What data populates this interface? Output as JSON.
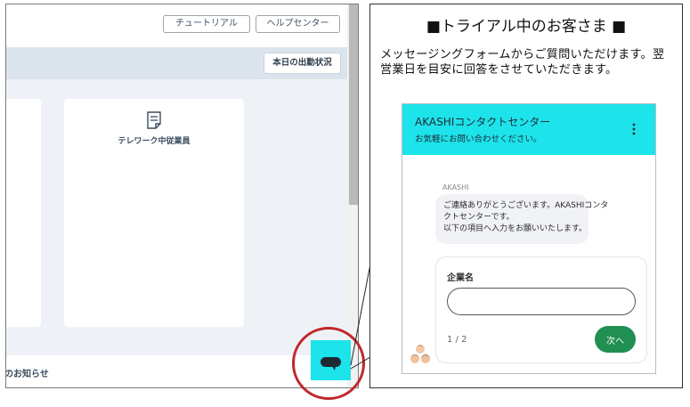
{
  "app": {
    "toolbar": {
      "tutorial_label": "チュートリアル",
      "help_label": "ヘルプセンター"
    },
    "subbar": {
      "today_button_label": "本日の出勤状況"
    },
    "cards": [
      {
        "label": "テレワーク中従業員",
        "icon": "document-icon"
      }
    ],
    "footer": {
      "news_label": "のお知らせ"
    },
    "chat_launcher": {
      "icon": "chat-bubble-icon"
    }
  },
  "callout": {
    "title": "■トライアル中のお客さま ■",
    "description": "メッセージングフォームからご質問いただけます。翌営業日を目安に回答をさせていただきます。"
  },
  "chat": {
    "header": {
      "title": "AKASHIコンタクトセンター",
      "subtitle": "お気軽にお問い合わせください。"
    },
    "sender": "AKASHI",
    "message_lines": [
      "ご連絡ありがとうございます。AKASHIコンタ",
      "クトセンターです。",
      "以下の項目へ入力をお願いいたします。"
    ],
    "form": {
      "field_label": "企業名",
      "field_value": "",
      "step": "1 / 2",
      "next_label": "次へ"
    }
  },
  "colors": {
    "accent": "#1de3ea",
    "highlight": "#c0282d",
    "next_button": "#1f8f52",
    "subbar": "#dbe4ec"
  }
}
